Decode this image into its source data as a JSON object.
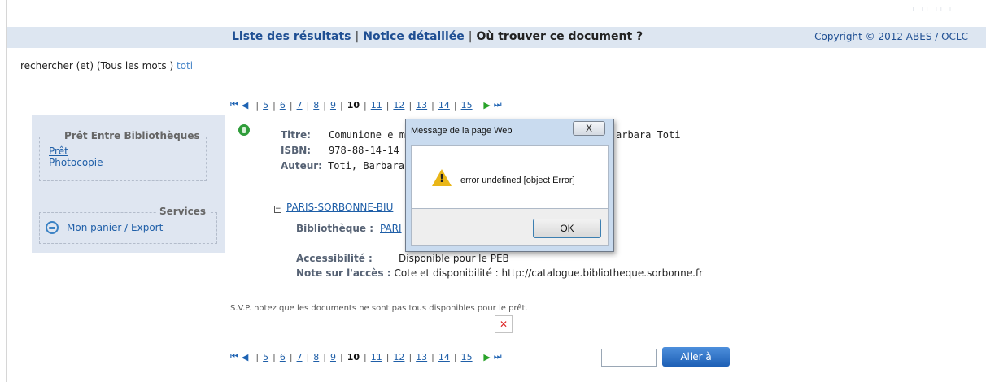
{
  "header": {
    "nav": [
      "Liste des résultats",
      "Notice détaillée",
      "Où trouver ce document ?"
    ],
    "copyright": "Copyright © 2012 ABES / OCLC"
  },
  "query": {
    "text": "rechercher (et) (Tous les mots )",
    "term": "toti"
  },
  "pager": {
    "pages": [
      "5",
      "6",
      "7",
      "8",
      "9",
      "10",
      "11",
      "12",
      "13",
      "14",
      "15"
    ],
    "current": "10",
    "goto_button": "Aller à"
  },
  "sidebar": {
    "peb_title": "Prêt Entre Bibliothèques",
    "peb_links": [
      "Prêt",
      "Photocopie"
    ],
    "services_title": "Services",
    "services_link": "Mon panier / Export"
  },
  "record": {
    "title_label": "Titre:",
    "title_value": "Comunione e m",
    "title_tail": "arbara Toti",
    "isbn_label": "ISBN:",
    "isbn_value": "978-88-14-14",
    "author_label": "Auteur:",
    "author_value": "Toti, Barbara",
    "library_toggle": "PARIS-SORBONNE-BIU",
    "bibliotheque_label": "Bibliothèque :",
    "bibliotheque_value": "PARI",
    "access_label": "Accessibilité :",
    "access_value": "Disponible pour le PEB",
    "note_label": "Note sur l'accès :",
    "note_value": "Cote et disponibilité : http://catalogue.bibliotheque.sorbonne.fr"
  },
  "notice": "S.V.P. notez que les documents ne sont pas tous disponibles pour le prêt.",
  "dialog": {
    "title": "Message de la page Web",
    "close": "X",
    "message": "error undefined [object Error]",
    "ok": "OK"
  }
}
